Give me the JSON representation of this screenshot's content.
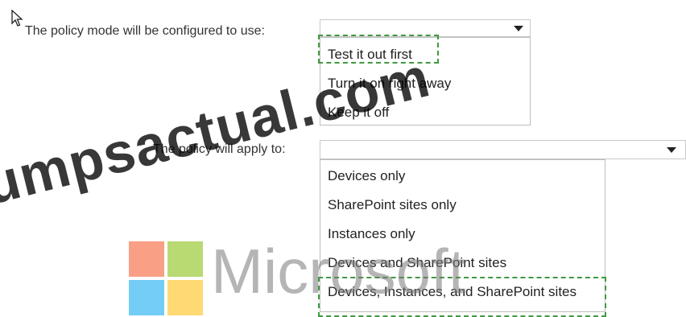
{
  "policy_mode": {
    "label": "The policy mode will be configured to use:",
    "selected": "",
    "options": [
      "Test it out first",
      "Turn it on right away",
      "Keep it off"
    ],
    "highlighted_option": "Test it out first"
  },
  "policy_apply": {
    "label": "The policy will apply to:",
    "selected": "",
    "options": [
      "Devices only",
      "SharePoint sites only",
      "Instances only",
      "Devices and SharePoint sites",
      "Devices, Instances, and SharePoint sites"
    ],
    "highlighted_option": "Devices, Instances, and SharePoint sites"
  },
  "watermark": {
    "text": "umpsactual.com"
  },
  "logo": {
    "text": "Microsoft",
    "colors": [
      "#f25022",
      "#7fba00",
      "#00a4ef",
      "#ffb900"
    ]
  },
  "icons": {
    "cursor": "mouse-pointer-icon",
    "caret": "chevron-down-icon"
  },
  "colors": {
    "highlight_dash": "#3f9a3f"
  }
}
